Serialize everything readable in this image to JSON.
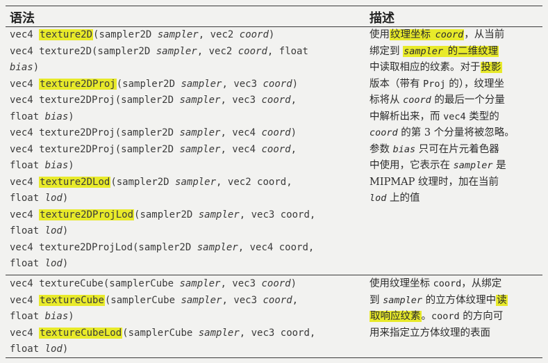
{
  "header": {
    "syntax": "语法",
    "description": "描述"
  },
  "section1": {
    "syntax_lines": [
      [
        {
          "t": "vec4 "
        },
        {
          "t": "texture2D",
          "hl": true
        },
        {
          "t": "(sampler2D "
        },
        {
          "t": "sampler",
          "i": true
        },
        {
          "t": ", vec2 "
        },
        {
          "t": "coord",
          "i": true
        },
        {
          "t": ")"
        }
      ],
      [
        {
          "t": "vec4 texture2D(sampler2D "
        },
        {
          "t": "sampler",
          "i": true
        },
        {
          "t": ", vec2 "
        },
        {
          "t": "coord",
          "i": true
        },
        {
          "t": ", float"
        }
      ],
      [
        {
          "t": "bias",
          "i": true
        },
        {
          "t": ")"
        }
      ],
      [
        {
          "t": "vec4 "
        },
        {
          "t": "texture2DProj",
          "hl": true
        },
        {
          "t": "(sampler2D "
        },
        {
          "t": "sampler",
          "i": true
        },
        {
          "t": ", vec3 "
        },
        {
          "t": "coord",
          "i": true
        },
        {
          "t": ")"
        }
      ],
      [
        {
          "t": "vec4 texture2DProj(sampler2D "
        },
        {
          "t": "sampler",
          "i": true
        },
        {
          "t": ", vec3 "
        },
        {
          "t": "coord",
          "i": true
        },
        {
          "t": ","
        }
      ],
      [
        {
          "t": "float "
        },
        {
          "t": "bias",
          "i": true
        },
        {
          "t": ")"
        }
      ],
      [
        {
          "t": "vec4 texture2DProj(sampler2D "
        },
        {
          "t": "sampler",
          "i": true
        },
        {
          "t": ", vec4 "
        },
        {
          "t": "coord",
          "i": true
        },
        {
          "t": ")"
        }
      ],
      [
        {
          "t": "vec4 texture2DProj(sampler2D "
        },
        {
          "t": "sampler",
          "i": true
        },
        {
          "t": ", vec4 "
        },
        {
          "t": "coord",
          "i": true
        },
        {
          "t": ","
        }
      ],
      [
        {
          "t": "float "
        },
        {
          "t": "bias",
          "i": true
        },
        {
          "t": ")"
        }
      ],
      [
        {
          "t": "vec4 "
        },
        {
          "t": "texture2DLod",
          "hl": true
        },
        {
          "t": "(sampler2D "
        },
        {
          "t": "sampler",
          "i": true
        },
        {
          "t": ", vec2 coord,"
        }
      ],
      [
        {
          "t": "float "
        },
        {
          "t": "lod",
          "i": true
        },
        {
          "t": ")"
        }
      ],
      [
        {
          "t": "vec4 "
        },
        {
          "t": "texture2DProjLod",
          "hl": true
        },
        {
          "t": "(sampler2D "
        },
        {
          "t": "sampler",
          "i": true
        },
        {
          "t": ", vec3 coord,"
        }
      ],
      [
        {
          "t": "float "
        },
        {
          "t": "lod",
          "i": true
        },
        {
          "t": ")"
        }
      ],
      [
        {
          "t": "vec4 texture2DProjLod(sampler2D "
        },
        {
          "t": "sampler",
          "i": true
        },
        {
          "t": ", vec4 coord,"
        }
      ],
      [
        {
          "t": "float "
        },
        {
          "t": "lod",
          "i": true
        },
        {
          "t": ")"
        }
      ]
    ],
    "desc_lines": [
      [
        {
          "t": "使用"
        },
        {
          "t": "纹理坐标 ",
          "hl": true
        },
        {
          "t": "coord",
          "i": true,
          "m": true,
          "hl": true
        },
        {
          "t": "，从当前"
        }
      ],
      [
        {
          "t": "绑定到 "
        },
        {
          "t": "sampler",
          "i": true,
          "m": true,
          "hl": true
        },
        {
          "t": " 的二维纹理",
          "hl": true
        }
      ],
      [
        {
          "t": "中读取相应的纹素。对于"
        },
        {
          "t": "投影",
          "hl": true
        }
      ],
      [
        {
          "t": "版本（带有 "
        },
        {
          "t": "Proj",
          "m": true
        },
        {
          "t": " 的），纹理坐"
        }
      ],
      [
        {
          "t": "标将从 "
        },
        {
          "t": "coord",
          "i": true,
          "m": true
        },
        {
          "t": " 的最后一个分量"
        }
      ],
      [
        {
          "t": "中解析出来，而 "
        },
        {
          "t": "vec4",
          "m": true
        },
        {
          "t": " 类型的"
        }
      ],
      [
        {
          "t": "coord",
          "i": true,
          "m": true
        },
        {
          "t": " 的第 3 个分量将被忽略。"
        }
      ],
      [
        {
          "t": "参数 "
        },
        {
          "t": "bias",
          "i": true,
          "m": true
        },
        {
          "t": " 只可在片元着色器"
        }
      ],
      [
        {
          "t": "中使用，它表示在 "
        },
        {
          "t": "sampler",
          "i": true,
          "m": true
        },
        {
          "t": " 是"
        }
      ],
      [
        {
          "t": "MIPMAP 纹理时，加在当前"
        }
      ],
      [
        {
          "t": "lod",
          "i": true,
          "m": true
        },
        {
          "t": " 上的值"
        }
      ]
    ]
  },
  "section2": {
    "syntax_lines": [
      [
        {
          "t": "vec4 textureCube(samplerCube "
        },
        {
          "t": "sampler",
          "i": true
        },
        {
          "t": ", vec3 "
        },
        {
          "t": "coord",
          "i": true
        },
        {
          "t": ")"
        }
      ],
      [
        {
          "t": "vec4 "
        },
        {
          "t": "textureCube",
          "hl": true
        },
        {
          "t": "(samplerCube "
        },
        {
          "t": "sampler",
          "i": true
        },
        {
          "t": ", vec3 "
        },
        {
          "t": "coord",
          "i": true
        },
        {
          "t": ","
        }
      ],
      [
        {
          "t": "float "
        },
        {
          "t": "bias",
          "i": true
        },
        {
          "t": ")"
        }
      ],
      [
        {
          "t": "vec4 "
        },
        {
          "t": "textureCubeLod",
          "hl": true
        },
        {
          "t": "(samplerCube "
        },
        {
          "t": "sampler",
          "i": true
        },
        {
          "t": ", vec3 coord,"
        }
      ],
      [
        {
          "t": "float "
        },
        {
          "t": "lod",
          "i": true
        },
        {
          "t": ")"
        }
      ]
    ],
    "desc_lines": [
      [
        {
          "t": "使用纹理坐标 "
        },
        {
          "t": "coord",
          "m": true
        },
        {
          "t": "，从绑定"
        }
      ],
      [
        {
          "t": "到 "
        },
        {
          "t": "sampler",
          "i": true,
          "m": true
        },
        {
          "t": " 的立方体纹理中"
        },
        {
          "t": "读",
          "hl": true
        }
      ],
      [
        {
          "t": "取响应纹素",
          "hl": true
        },
        {
          "t": "。"
        },
        {
          "t": "coord",
          "m": true
        },
        {
          "t": " 的方向可"
        }
      ],
      [
        {
          "t": "用来指定立方体纹理的表面"
        }
      ]
    ]
  }
}
